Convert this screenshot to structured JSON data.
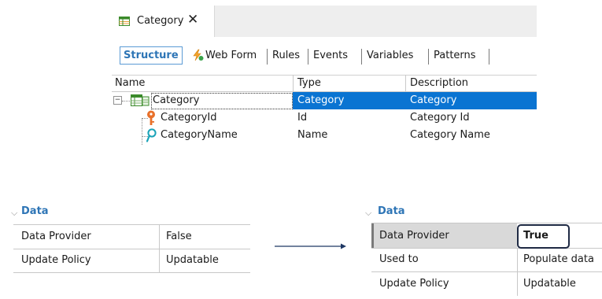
{
  "document_tab": {
    "icon": "transaction-table-icon",
    "label": "Category",
    "close": "✕"
  },
  "subtabs": [
    {
      "label": "Structure",
      "active": true
    },
    {
      "label": "Web Form",
      "icon": "webform-icon"
    },
    {
      "label": "Rules"
    },
    {
      "label": "Events"
    },
    {
      "label": "Variables"
    },
    {
      "label": "Patterns"
    }
  ],
  "grid": {
    "columns": [
      "Name",
      "Type",
      "Description"
    ],
    "rows": [
      {
        "name": "Category",
        "type": "Category",
        "description": "Category",
        "icon": "level-icon",
        "selected": true,
        "expander": "−"
      },
      {
        "name": "CategoryId",
        "type": "Id",
        "description": "Category Id",
        "icon": "primary-key-icon"
      },
      {
        "name": "CategoryName",
        "type": "Name",
        "description": "Category Name",
        "icon": "descriptor-attribute-icon"
      }
    ]
  },
  "properties_before": {
    "section": "Data",
    "rows": [
      {
        "name": "Data Provider",
        "value": "False"
      },
      {
        "name": "Update Policy",
        "value": "Updatable"
      }
    ]
  },
  "properties_after": {
    "section": "Data",
    "rows": [
      {
        "name": "Data Provider",
        "value": "True",
        "highlighted": true
      },
      {
        "name": "Used to",
        "value": "Populate data"
      },
      {
        "name": "Update Policy",
        "value": "Updatable"
      }
    ]
  },
  "colors": {
    "accent": "#2e75b6",
    "selection": "#0a74d2",
    "key_icon": "#e8702a",
    "descriptor_icon": "#1aa3b8"
  }
}
